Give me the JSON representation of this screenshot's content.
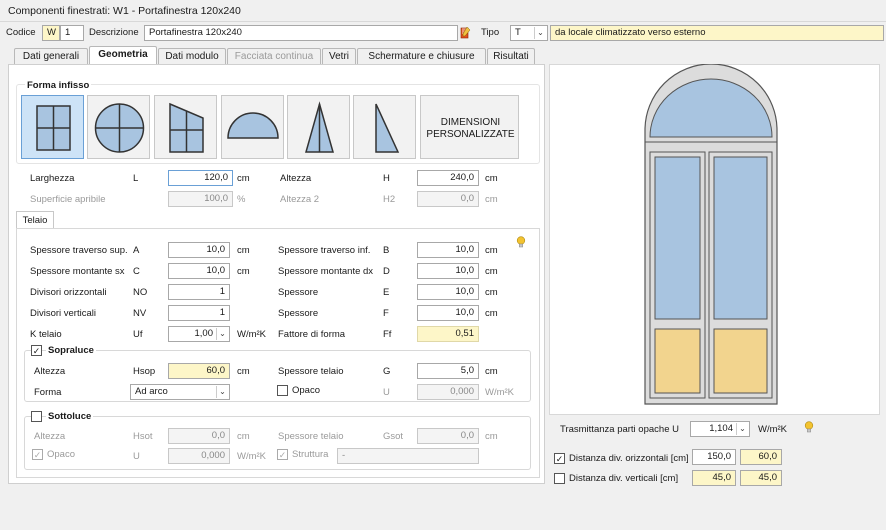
{
  "window": {
    "title": "Componenti finestrati: W1 - Portafinestra 120x240"
  },
  "header": {
    "codice_label": "Codice",
    "codice_prefix": "W",
    "codice_value": "1",
    "descrizione_label": "Descrizione",
    "descrizione_value": "Portafinestra 120x240",
    "tipo_label": "Tipo",
    "tipo_value": "T",
    "tipo_description": "da locale climatizzato verso esterno"
  },
  "tabs": [
    {
      "label": "Dati generali"
    },
    {
      "label": "Geometria"
    },
    {
      "label": "Dati modulo"
    },
    {
      "label": "Facciata continua"
    },
    {
      "label": "Vetri"
    },
    {
      "label": "Schermature e chiusure"
    },
    {
      "label": "Risultati"
    }
  ],
  "forma": {
    "title": "Forma infisso",
    "custom_label_1": "DIMENSIONI",
    "custom_label_2": "PERSONALIZZATE"
  },
  "dims": {
    "larghezza_label": "Larghezza",
    "larghezza_sym": "L",
    "larghezza_value": "120,0",
    "larghezza_unit": "cm",
    "altezza_label": "Altezza",
    "altezza_sym": "H",
    "altezza_value": "240,0",
    "altezza_unit": "cm",
    "superficie_label": "Superficie apribile",
    "superficie_value": "100,0",
    "superficie_unit": "%",
    "altezza2_label": "Altezza 2",
    "altezza2_sym": "H2",
    "altezza2_value": "0,0",
    "altezza2_unit": "cm"
  },
  "telaio": {
    "tab_label": "Telaio",
    "left_rows": [
      {
        "label": "Spessore traverso sup.",
        "sym": "A",
        "value": "10,0",
        "unit": "cm"
      },
      {
        "label": "Spessore montante sx",
        "sym": "C",
        "value": "10,0",
        "unit": "cm"
      },
      {
        "label": "Divisori orizzontali",
        "sym": "NO",
        "value": "1",
        "unit": ""
      },
      {
        "label": "Divisori verticali",
        "sym": "NV",
        "value": "1",
        "unit": ""
      }
    ],
    "right_rows": [
      {
        "label": "Spessore traverso inf.",
        "sym": "B",
        "value": "10,0",
        "unit": "cm"
      },
      {
        "label": "Spessore montante dx",
        "sym": "D",
        "value": "10,0",
        "unit": "cm"
      },
      {
        "label": "Spessore",
        "sym": "E",
        "value": "10,0",
        "unit": "cm"
      },
      {
        "label": "Spessore",
        "sym": "F",
        "value": "10,0",
        "unit": "cm"
      }
    ],
    "k_label": "K telaio",
    "k_sym": "Uf",
    "k_value": "1,00",
    "k_unit": "W/m²K",
    "ff_label": "Fattore di forma",
    "ff_sym": "Ff",
    "ff_value": "0,51"
  },
  "sopraluce": {
    "title": "Sopraluce",
    "altezza_label": "Altezza",
    "altezza_sym": "Hsop",
    "altezza_value": "60,0",
    "altezza_unit": "cm",
    "forma_label": "Forma",
    "forma_value": "Ad arco",
    "spessore_label": "Spessore telaio",
    "spessore_sym": "G",
    "spessore_value": "5,0",
    "spessore_unit": "cm",
    "opaco_label": "Opaco",
    "u_sym": "U",
    "u_value": "0,000",
    "u_unit": "W/m²K"
  },
  "sottoluce": {
    "title": "Sottoluce",
    "altezza_label": "Altezza",
    "altezza_sym": "Hsot",
    "altezza_value": "0,0",
    "altezza_unit": "cm",
    "spessore_label": "Spessore telaio",
    "spessore_sym": "Gsot",
    "spessore_value": "0,0",
    "spessore_unit": "cm",
    "opaco_label": "Opaco",
    "u_sym": "U",
    "u_value": "0,000",
    "u_unit": "W/m²K",
    "struttura_label": "Struttura",
    "struttura_value": "-"
  },
  "right": {
    "trasm_label": "Trasmittanza parti opache U",
    "trasm_value": "1,104",
    "trasm_unit": "W/m²K",
    "dist_orizz_label": "Distanza div. orizzontali [cm]",
    "dist_orizz_v1": "150,0",
    "dist_orizz_v2": "60,0",
    "dist_vert_label": "Distanza div. verticali [cm]",
    "dist_vert_v1": "45,0",
    "dist_vert_v2": "45,0"
  },
  "colors": {
    "glass": "#a8c4e0",
    "opaque": "#f2d48e",
    "frame": "#dcdcdc",
    "accent": "#cde3f7",
    "field_highlight": "#fdf6c8"
  }
}
